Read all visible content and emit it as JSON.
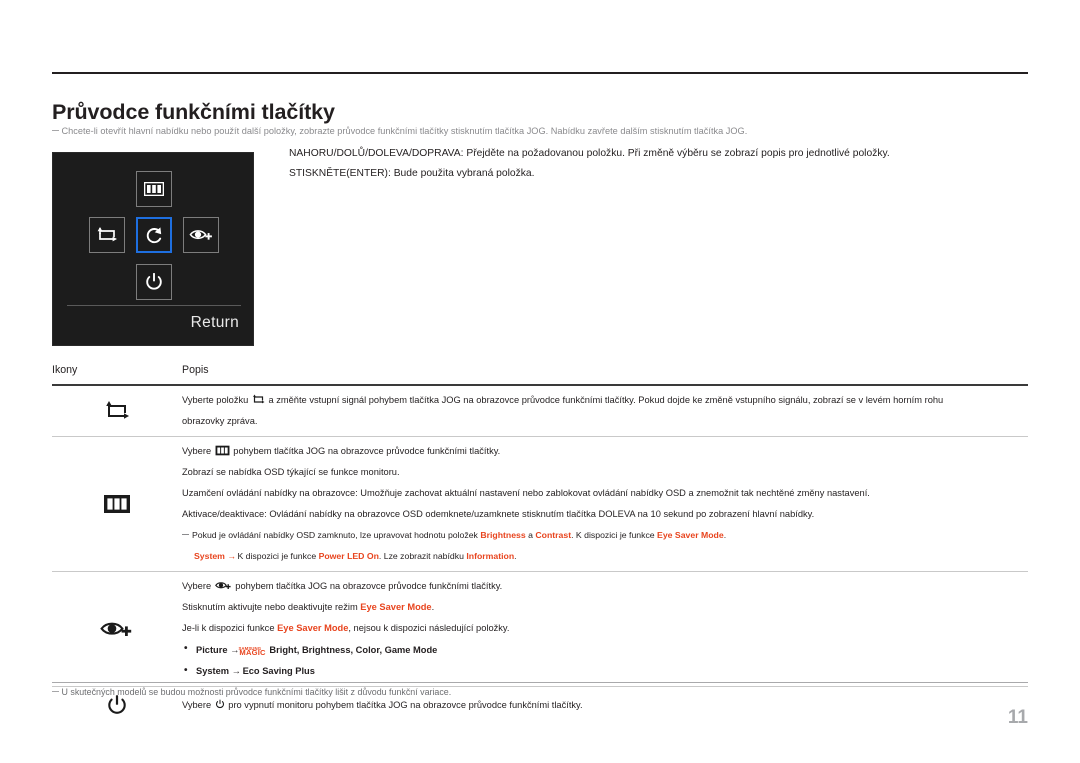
{
  "document": {
    "title": "Průvodce funkčními tlačítky",
    "intro_note": "Chcete-li otevřít hlavní nabídku nebo použít další položky, zobrazte průvodce funkčními tlačítky stisknutím tlačítka JOG. Nabídku zavřete dalším stisknutím tlačítka JOG.",
    "page_number": "11",
    "footer_note": "U skutečných modelů se budou možnosti průvodce funkčními tlačítky lišit z důvodu funkční variace."
  },
  "instructions": [
    "NAHORU/DOLŮ/DOLEVA/DOPRAVA: Přejděte na požadovanou položku. Při změně výběru se zobrazí popis pro jednotlivé položky.",
    "STISKNĚTE(ENTER): Bude použita vybraná položka."
  ],
  "osd_panel": {
    "return_label": "Return",
    "keys": [
      {
        "position": "up",
        "icon": "menu-bars-icon",
        "selected": false
      },
      {
        "position": "left",
        "icon": "source-loop-icon",
        "selected": false
      },
      {
        "position": "center",
        "icon": "return-arrow-icon",
        "selected": true
      },
      {
        "position": "right",
        "icon": "eye-plus-icon",
        "selected": false
      },
      {
        "position": "down",
        "icon": "power-icon",
        "selected": false
      }
    ],
    "selection_color": "#1e6fe0",
    "background_color": "#1c1c1c"
  },
  "table": {
    "headers": {
      "icons": "Ikony",
      "description": "Popis"
    },
    "rows": [
      {
        "icon": "source-loop-icon",
        "lines": [
          "Vyberte položku ⟲ a změňte vstupní signál pohybem tlačítka JOG na obrazovce průvodce funkčními tlačítky. Pokud dojde ke změně vstupního signálu, zobrazí se v levém horním rohu",
          "obrazovky zpráva."
        ]
      },
      {
        "icon": "menu-bars-icon",
        "lines": [
          "Vybere  pohybem tlačítka JOG na obrazovce průvodce funkčními tlačítky.",
          "Zobrazí se nabídka OSD týkající se funkce monitoru.",
          "Uzamčení ovládání nabídky na obrazovce: Umožňuje zachovat aktuální nastavení nebo zablokovat ovládání nabídky OSD a znemožnit tak nechtěné změny nastavení.",
          "Aktivace/deaktivace: Ovládání nabídky na obrazovce OSD odemknete/uzamknete stisknutím tlačítka DOLEVA na 10 sekund po zobrazení hlavní nabídky."
        ],
        "subnote": {
          "line1_pre": "Pokud je ovládání nabídky OSD zamknuto, lze upravovat hodnotu položek ",
          "hl1": "Brightness",
          "line1_mid1": " a ",
          "hl2": "Contrast",
          "line1_mid2": ". K dispozici je funkce ",
          "hl3": "Eye Saver Mode",
          "line1_end": ".",
          "line2_hl1": "System",
          "line2_arrow": "→",
          "line2_mid1": " K dispozici je funkce ",
          "line2_hl2": "Power LED On",
          "line2_mid2": ". Lze zobrazit nabídku ",
          "line2_hl3": "Information",
          "line2_end": "."
        }
      },
      {
        "icon": "eye-plus-icon",
        "line1_pre": "Vybere ",
        "line1_post": " pohybem tlačítka JOG na obrazovce průvodce funkčními tlačítky.",
        "line2_pre": "Stisknutím aktivujte nebo deaktivujte režim ",
        "line2_hl": "Eye Saver Mode",
        "line2_end": ".",
        "line3_pre": "Je-li k dispozici funkce ",
        "line3_hl": "Eye Saver Mode",
        "line3_end": ", nejsou k dispozici následující položky.",
        "bullets": [
          {
            "label": "Picture",
            "arrow": "→",
            "logo_samsung": "SAMSUNG",
            "logo_magic": "MAGIC",
            "rest": "Bright, Brightness, Color, Game Mode"
          },
          {
            "label": "System",
            "arrow": "→",
            "rest": "Eco Saving Plus"
          }
        ]
      },
      {
        "icon": "power-icon",
        "line_pre": "Vybere ",
        "line_post": " pro vypnutí monitoru pohybem tlačítka JOG na obrazovce průvodce funkčními tlačítky."
      }
    ]
  },
  "colors": {
    "highlight": "#e8451f",
    "text": "#231f20",
    "muted": "#8a8a8d",
    "page_number": "#a7a9ac"
  }
}
